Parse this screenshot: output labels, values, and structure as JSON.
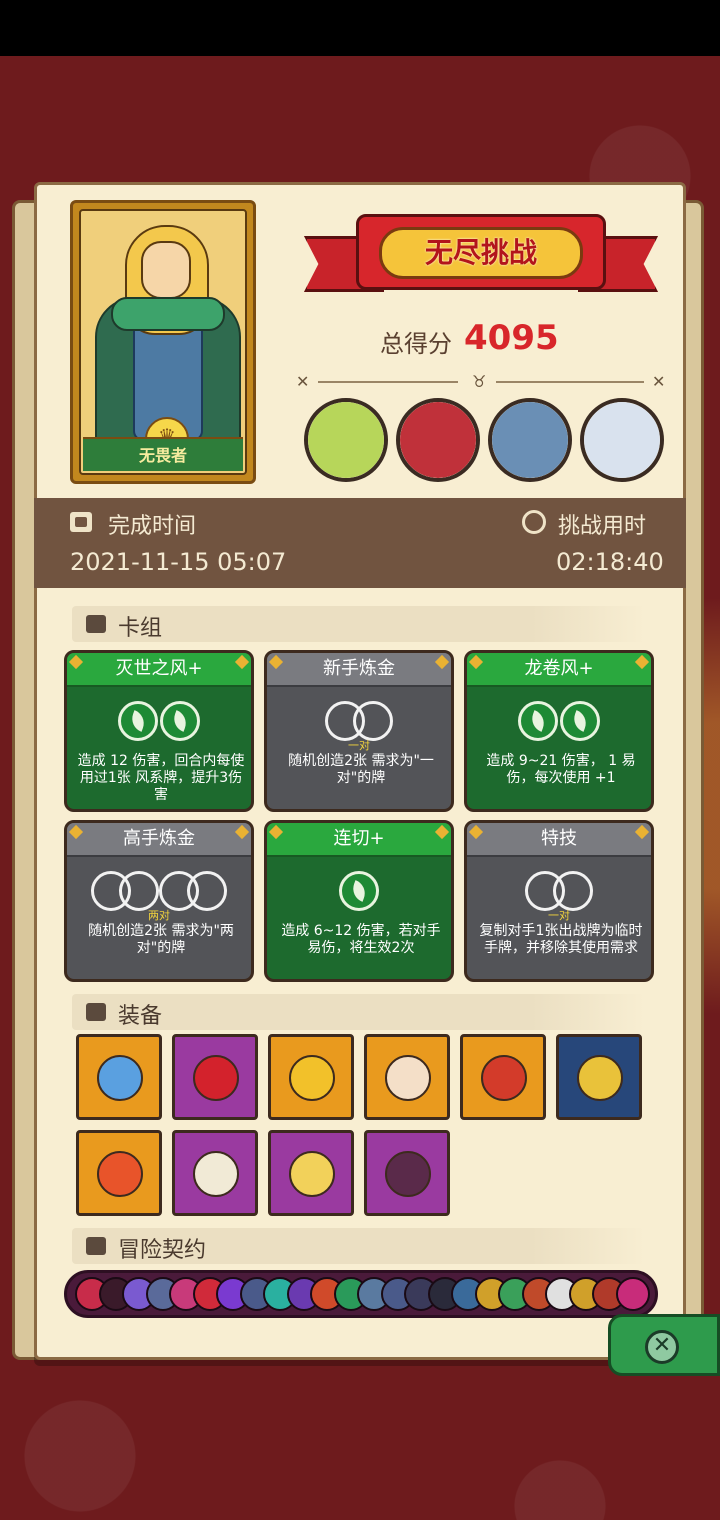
{
  "hero": {
    "name": "无畏者"
  },
  "mode": {
    "title": "无尽挑战"
  },
  "score": {
    "label": "总得分",
    "value": "4095"
  },
  "bosses": [
    {
      "name": "boss-1",
      "color": "#b7d65a"
    },
    {
      "name": "boss-2",
      "color": "#c0313a"
    },
    {
      "name": "boss-3",
      "color": "#6a8fb5"
    },
    {
      "name": "boss-4",
      "color": "#d9e2ee"
    }
  ],
  "info": {
    "finish_label": "完成时间",
    "finish_value": "2021-11-15 05:07",
    "duration_label": "挑战用时",
    "duration_value": "02:18:40"
  },
  "sections": {
    "deck": "卡组",
    "equipment": "装备",
    "contracts": "冒险契约"
  },
  "cards": [
    {
      "title": "灭世之风+",
      "style": "green",
      "gems": 2,
      "sub": "",
      "desc": "造成 12 伤害，回合内每使用过1张 风系牌，提升3伤害"
    },
    {
      "title": "新手炼金",
      "style": "gray",
      "gems": 2,
      "sub": "一对",
      "desc": "随机创造2张 需求为\"一对\"的牌"
    },
    {
      "title": "龙卷风+",
      "style": "green",
      "gems": 2,
      "sub": "",
      "desc": "造成 9~21 伤害， 1 易伤，每次使用 +1"
    },
    {
      "title": "高手炼金",
      "style": "gray",
      "gems": 4,
      "sub": "两对",
      "desc": "随机创造2张 需求为\"两对\"的牌"
    },
    {
      "title": "连切+",
      "style": "green",
      "gems": 1,
      "sub": "",
      "desc": "造成 6~12 伤害，若对手 易伤，将生效2次"
    },
    {
      "title": "特技",
      "style": "gray",
      "gems": 2,
      "sub": "一对",
      "desc": "复制对手1张出战牌为临时手牌，并移除其使用需求"
    }
  ],
  "equipment": [
    {
      "name": "blue-slime-item",
      "bg": "#e99a1e",
      "art": "#5aa0e0"
    },
    {
      "name": "red-crystal-item",
      "bg": "#9a3aa0",
      "art": "#d3222c"
    },
    {
      "name": "gold-coin-item",
      "bg": "#e99a1e",
      "art": "#f2c12a"
    },
    {
      "name": "donut-item",
      "bg": "#e99a1e",
      "art": "#f4dfc8"
    },
    {
      "name": "tribal-mask-item",
      "bg": "#e99a1e",
      "art": "#d33b2a"
    },
    {
      "name": "gold-helmet-item",
      "bg": "#27477a",
      "art": "#e9c23a"
    },
    {
      "name": "phoenix-feather-item",
      "bg": "#e99a1e",
      "art": "#e8542a"
    },
    {
      "name": "fang-item",
      "bg": "#9a3aa0",
      "art": "#f1ead6"
    },
    {
      "name": "mirror-item",
      "bg": "#9a3aa0",
      "art": "#f2d15a"
    },
    {
      "name": "dark-armor-item",
      "bg": "#9a3aa0",
      "art": "#5a2a4a"
    }
  ],
  "contracts": [
    "#c82c4a",
    "#3a1a2a",
    "#7a5ad0",
    "#5a6a9a",
    "#c83a7a",
    "#d02a3a",
    "#7a3ad0",
    "#4a5a8a",
    "#2ab0a0",
    "#6a3ab0",
    "#d04a2a",
    "#2a9a5a",
    "#5a7aa0",
    "#4a5a8a",
    "#3a3a5a",
    "#2a2a3a",
    "#3a6a9a",
    "#d0a02a",
    "#3aa05a",
    "#c04a2a",
    "#e0e0e0",
    "#d0a02a",
    "#b03a2a",
    "#c82c7a"
  ]
}
